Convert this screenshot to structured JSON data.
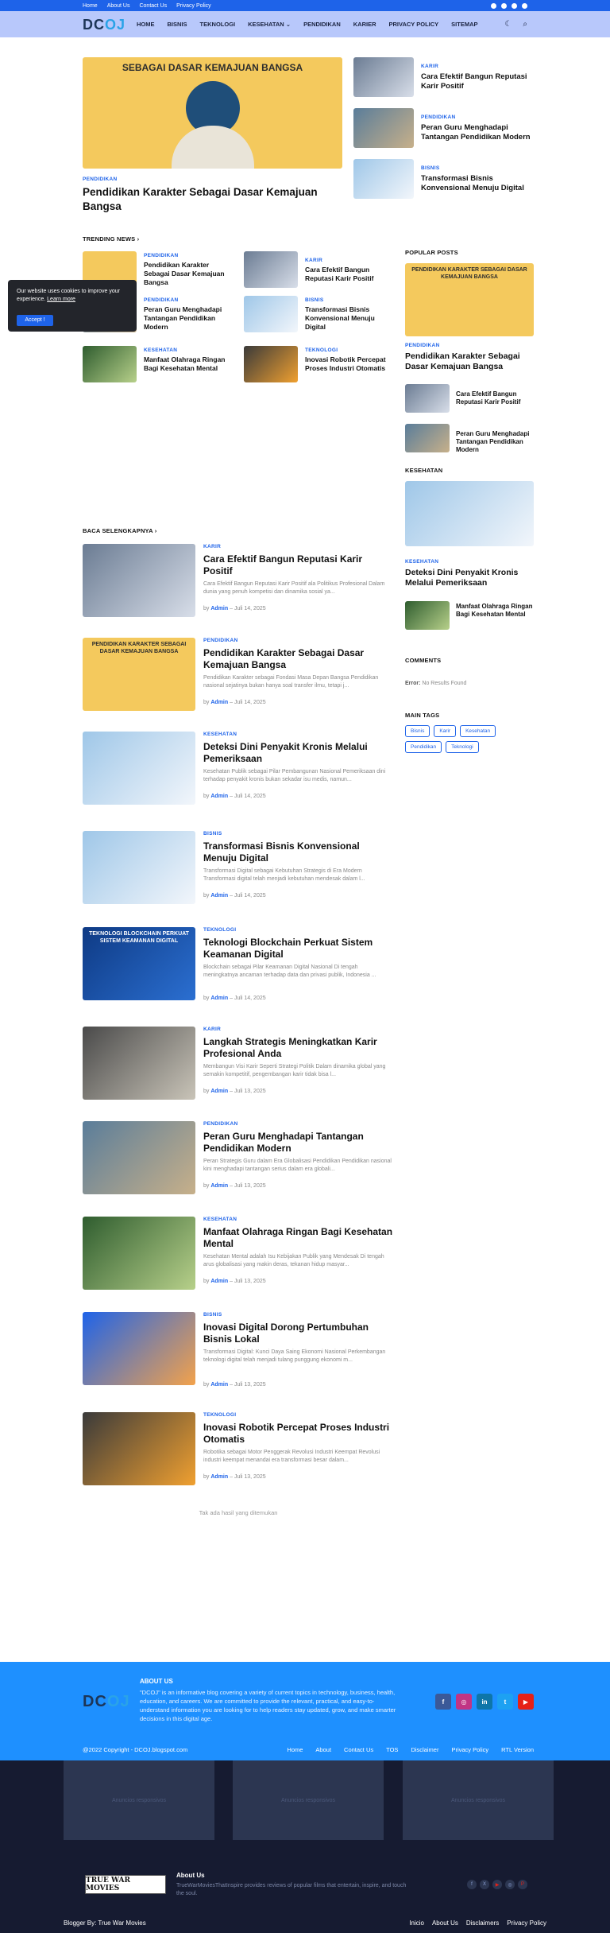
{
  "topbar": {
    "links": [
      "Home",
      "About Us",
      "Contact Us",
      "Privacy Policy"
    ],
    "social_icons": [
      "facebook-icon",
      "instagram-icon",
      "linkedin-icon",
      "twitter-icon"
    ]
  },
  "nav": {
    "logo_part_a": "DC",
    "logo_part_b": "OJ",
    "menu": [
      "HOME",
      "BISNIS",
      "TEKNOLOGI",
      "KESEHATAN",
      "PENDIDIKAN",
      "KARIER",
      "PRIVACY POLICY",
      "SITEMAP"
    ],
    "kesehatan_chevron": "⌄",
    "moon_glyph": "☾",
    "search_glyph": "⌕"
  },
  "hero": {
    "image_caption": "SEBAGAI DASAR KEMAJUAN BANGSA",
    "category": "PENDIDIKAN",
    "title": "Pendidikan Karakter Sebagai Dasar Kemajuan Bangsa"
  },
  "side_posts": [
    {
      "category": "KARIR",
      "title": "Cara Efektif Bangun Reputasi Karir Positif"
    },
    {
      "category": "PENDIDIKAN",
      "title": "Peran Guru Menghadapi Tantangan Pendidikan Modern"
    },
    {
      "category": "BISNIS",
      "title": "Transformasi Bisnis Konvensional Menuju Digital"
    }
  ],
  "trending": {
    "heading": "TRENDING NEWS",
    "heading_arrow": "›",
    "items": [
      {
        "category": "PENDIDIKAN",
        "title": "Pendidikan Karakter Sebagai Dasar Kemajuan Bangsa"
      },
      {
        "category": "KARIR",
        "title": "Cara Efektif Bangun Reputasi Karir Positif"
      },
      {
        "category": "PENDIDIKAN",
        "title": "Peran Guru Menghadapi Tantangan Pendidikan Modern"
      },
      {
        "category": "BISNIS",
        "title": "Transformasi Bisnis Konvensional Menuju Digital"
      },
      {
        "category": "KESEHATAN",
        "title": "Manfaat Olahraga Ringan Bagi Kesehatan Mental"
      },
      {
        "category": "TEKNOLOGI",
        "title": "Inovasi Robotik Percepat Proses Industri Otomatis"
      }
    ]
  },
  "cookie": {
    "text": "Our website uses cookies to improve your experience.",
    "link": "Learn more",
    "button": "Accept !"
  },
  "read_more": {
    "heading": "BACA SELENGKAPNYA",
    "heading_arrow": "›",
    "by": "by",
    "posts": [
      {
        "category": "KARIR",
        "title": "Cara Efektif Bangun Reputasi Karir Positif",
        "excerpt": "Cara Efektif Bangun Reputasi Karir Positif ala Politikus Profesional Dalam dunia yang penuh kompetisi dan dinamika sosial ya...",
        "author": "Admin",
        "date": "Juli 14, 2025"
      },
      {
        "category": "PENDIDIKAN",
        "title": "Pendidikan Karakter Sebagai Dasar Kemajuan Bangsa",
        "excerpt": "Pendidikan Karakter sebagai Fondasi Masa Depan Bangsa Pendidikan nasional sejatinya bukan hanya soal transfer ilmu, tetapi j...",
        "author": "Admin",
        "date": "Juli 14, 2025",
        "image_caption": "PENDIDIKAN KARAKTER SEBAGAI DASAR KEMAJUAN BANGSA"
      },
      {
        "category": "KESEHATAN",
        "title": "Deteksi Dini Penyakit Kronis Melalui Pemeriksaan",
        "excerpt": "Kesehatan Publik sebagai Pilar Pembangunan Nasional Pemeriksaan dini terhadap penyakit kronis bukan sekadar isu medis, namun...",
        "author": "Admin",
        "date": "Juli 14, 2025"
      },
      {
        "category": "BISNIS",
        "title": "Transformasi Bisnis Konvensional Menuju Digital",
        "excerpt": "Transformasi Digital sebagai Kebutuhan Strategis di Era Modern Transformasi digital telah menjadi kebutuhan mendesak dalam l...",
        "author": "Admin",
        "date": "Juli 14, 2025"
      },
      {
        "category": "TEKNOLOGI",
        "title": "Teknologi Blockchain Perkuat Sistem Keamanan Digital",
        "excerpt": "Blockchain sebagai Pilar Keamanan Digital Nasional Di tengah meningkatnya ancaman terhadap data dan privasi publik, Indonesia ...",
        "author": "Admin",
        "date": "Juli 14, 2025",
        "image_caption": "TEKNOLOGI BLOCKCHAIN PERKUAT SISTEM KEAMANAN DIGITAL"
      },
      {
        "category": "KARIR",
        "title": "Langkah Strategis Meningkatkan Karir Profesional Anda",
        "excerpt": "Membangun Visi Karir Seperti Strategi Politik Dalam dinamika global yang semakin kompetitif, pengembangan karir tidak bisa l...",
        "author": "Admin",
        "date": "Juli 13, 2025"
      },
      {
        "category": "PENDIDIKAN",
        "title": "Peran Guru Menghadapi Tantangan Pendidikan Modern",
        "excerpt": "Peran Strategis Guru dalam Era Globalisasi Pendidikan Pendidikan nasional kini menghadapi tantangan serius dalam era globali...",
        "author": "Admin",
        "date": "Juli 13, 2025"
      },
      {
        "category": "KESEHATAN",
        "title": "Manfaat Olahraga Ringan Bagi Kesehatan Mental",
        "excerpt": "Kesehatan Mental adalah Isu Kebijakan Publik yang Mendesak Di tengah arus globalisasi yang makin deras, tekanan hidup masyar...",
        "author": "Admin",
        "date": "Juli 13, 2025"
      },
      {
        "category": "BISNIS",
        "title": "Inovasi Digital Dorong Pertumbuhan Bisnis Lokal",
        "excerpt": "Transformasi Digital: Kunci Daya Saing Ekonomi Nasional Perkembangan teknologi digital telah menjadi tulang punggung ekonomi m...",
        "author": "Admin",
        "date": "Juli 13, 2025"
      },
      {
        "category": "TEKNOLOGI",
        "title": "Inovasi Robotik Percepat Proses Industri Otomatis",
        "excerpt": "Robotika sebagai Motor Penggerak Revolusi Industri Keempat Revolusi industri keempat menandai era transformasi besar dalam...",
        "author": "Admin",
        "date": "Juli 13, 2025"
      }
    ],
    "no_more": "Tak ada hasil yang ditemukan"
  },
  "sidebar": {
    "popular_heading": "POPULAR POSTS",
    "popular_big": {
      "image_caption": "PENDIDIKAN KARAKTER SEBAGAI DASAR KEMAJUAN BANGSA",
      "category": "PENDIDIKAN",
      "title": "Pendidikan Karakter Sebagai Dasar Kemajuan Bangsa"
    },
    "popular_small": [
      {
        "title": "Cara Efektif Bangun Reputasi Karir Positif"
      },
      {
        "title": "Peran Guru Menghadapi Tantangan Pendidikan Modern"
      }
    ],
    "kesehatan_heading": "KESEHATAN",
    "kesehatan_big": {
      "category": "KESEHATAN",
      "title": "Deteksi Dini Penyakit Kronis Melalui Pemeriksaan"
    },
    "kesehatan_small": {
      "title": "Manfaat Olahraga Ringan Bagi Kesehatan Mental"
    },
    "comments_heading": "COMMENTS",
    "comments_error_label": "Error:",
    "comments_error": "No Results Found",
    "tags_heading": "MAIN TAGS",
    "tags": [
      "Bisnis",
      "Karir",
      "Kesehatan",
      "Pendidikan",
      "Teknologi"
    ]
  },
  "footer": {
    "logo_part_a": "DC",
    "logo_part_b": "OJ",
    "about_heading": "ABOUT US",
    "about_text": "\"DCOJ\" is an informative blog covering a variety of current topics in technology, business, health, education, and careers. We are committed to provide the relevant, practical, and easy-to-understand information you are looking for to help readers stay updated, grow, and make smarter decisions in this digital age.",
    "social": [
      {
        "icon": "facebook-icon",
        "glyph": "f",
        "color": "#3b5998"
      },
      {
        "icon": "instagram-icon",
        "glyph": "◎",
        "color": "#c13584"
      },
      {
        "icon": "linkedin-icon",
        "glyph": "in",
        "color": "#0e76a8"
      },
      {
        "icon": "twitter-icon",
        "glyph": "t",
        "color": "#1da1f2"
      },
      {
        "icon": "youtube-icon",
        "glyph": "▶",
        "color": "#e62117"
      }
    ],
    "copyright": "@2022 Copyright - DCOJ.blogspot.com",
    "links": [
      "Home",
      "About",
      "Contact Us",
      "TOS",
      "Disclaimer",
      "Privacy Policy",
      "RTL Version"
    ]
  },
  "ads_section": {
    "ad_label": "Anuncios responsivos",
    "tw_logo_text": "TRUE WAR MOVIES",
    "about_heading": "About Us",
    "about_text": "TrueWarMoviesThatInspire provides reviews of popular films that entertain, inspire, and touch the soul.",
    "social_glyphs": [
      "f",
      "X",
      "▶",
      "◎",
      "P"
    ],
    "bottom_left": "Blogger By: True War Movies",
    "bottom_links": [
      "Inicio",
      "About Us",
      "Disclaimers",
      "Privacy Policy"
    ]
  },
  "colors": {
    "accent": "#1e63e9",
    "nav_bg": "#b8c8fb",
    "footer_bg": "#1e90ff",
    "dark_bg": "#161b31"
  }
}
